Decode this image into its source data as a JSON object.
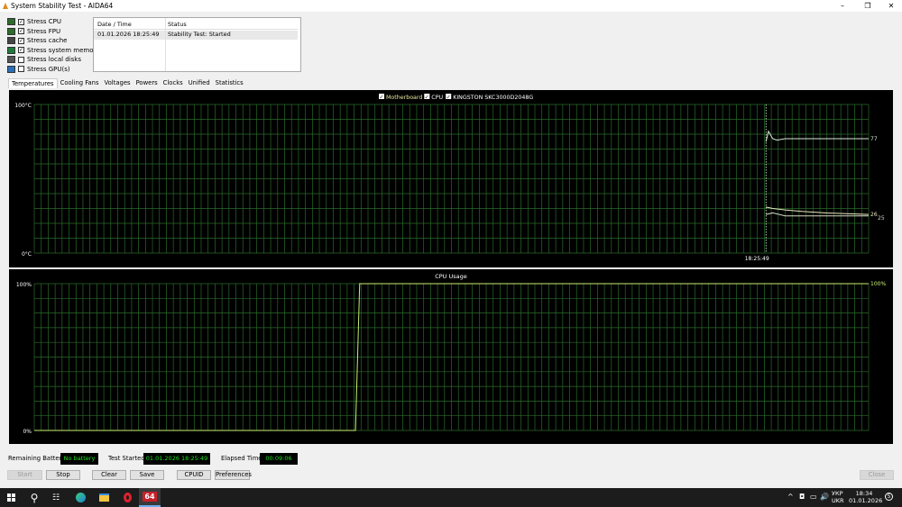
{
  "window": {
    "title": "System Stability Test - AIDA64",
    "minimize": "–",
    "maximize": "❐",
    "close": "✕"
  },
  "options": [
    {
      "label": "Stress CPU",
      "checked": true,
      "icon": "cpu-icon"
    },
    {
      "label": "Stress FPU",
      "checked": true,
      "icon": "fpu-icon"
    },
    {
      "label": "Stress cache",
      "checked": true,
      "icon": "cache-icon"
    },
    {
      "label": "Stress system memory",
      "checked": true,
      "icon": "memory-icon"
    },
    {
      "label": "Stress local disks",
      "checked": false,
      "icon": "disk-icon"
    },
    {
      "label": "Stress GPU(s)",
      "checked": false,
      "icon": "gpu-icon"
    }
  ],
  "log": {
    "headers": [
      "Date / Time",
      "Status"
    ],
    "rows": [
      [
        "01.01.2026 18:25:49",
        "Stability Test: Started"
      ]
    ]
  },
  "tabs": [
    "Temperatures",
    "Cooling Fans",
    "Voltages",
    "Powers",
    "Clocks",
    "Unified",
    "Statistics"
  ],
  "chart_data": [
    {
      "type": "line",
      "title": "",
      "legend": [
        {
          "name": "Motherboard",
          "checked": true,
          "color": "#e8e8a0"
        },
        {
          "name": "CPU",
          "checked": true,
          "color": "#ffffff"
        },
        {
          "name": "KINGSTON SKC3000D2048G",
          "checked": true,
          "color": "#ffffff"
        }
      ],
      "ylim": [
        0,
        100
      ],
      "y_top_label": "100°C",
      "y_bottom_label": "0°C",
      "marker_time": "18:25:49",
      "marker_pos": 0.877,
      "series": [
        {
          "name": "CPU",
          "color": "#d8ead8",
          "x": [
            0.877,
            0.88,
            0.885,
            0.89,
            0.9,
            0.95,
            1.0
          ],
          "y": [
            75,
            82,
            77,
            76,
            77,
            77,
            77
          ],
          "end_label": "77"
        },
        {
          "name": "Motherboard",
          "color": "#e8e8c0",
          "x": [
            0.877,
            0.885,
            0.9,
            0.92,
            0.95,
            1.0
          ],
          "y": [
            31,
            30,
            29,
            28,
            27,
            26
          ],
          "end_label": "26"
        },
        {
          "name": "KINGSTON SKC3000D2048G",
          "color": "#d8d8c8",
          "x": [
            0.877,
            0.885,
            0.9,
            1.0
          ],
          "y": [
            26,
            27,
            25,
            25
          ],
          "end_label": "25"
        }
      ]
    },
    {
      "type": "line",
      "title": "CPU Usage",
      "ylim": [
        0,
        100
      ],
      "y_top_label": "100%",
      "y_bottom_label": "0%",
      "series": [
        {
          "name": "CPU Usage",
          "color": "#c8f070",
          "x": [
            0,
            0.385,
            0.39,
            1.0
          ],
          "y": [
            0,
            0,
            100,
            100
          ],
          "end_label": "100%"
        }
      ]
    }
  ],
  "status": {
    "battery_label": "Remaining Battery:",
    "battery_value": "No battery",
    "started_label": "Test Started:",
    "started_value": "01.01.2026 18:25:49",
    "elapsed_label": "Elapsed Time:",
    "elapsed_value": "00:09:06"
  },
  "buttons": {
    "start": "Start",
    "stop": "Stop",
    "clear": "Clear",
    "save": "Save",
    "cpuid": "CPUID",
    "preferences": "Preferences",
    "close": "Close"
  },
  "taskbar": {
    "app_label": "64",
    "lang1": "УКР",
    "lang2": "UKR",
    "time": "18:34",
    "date": "01.01.2026",
    "notifications": "5"
  }
}
